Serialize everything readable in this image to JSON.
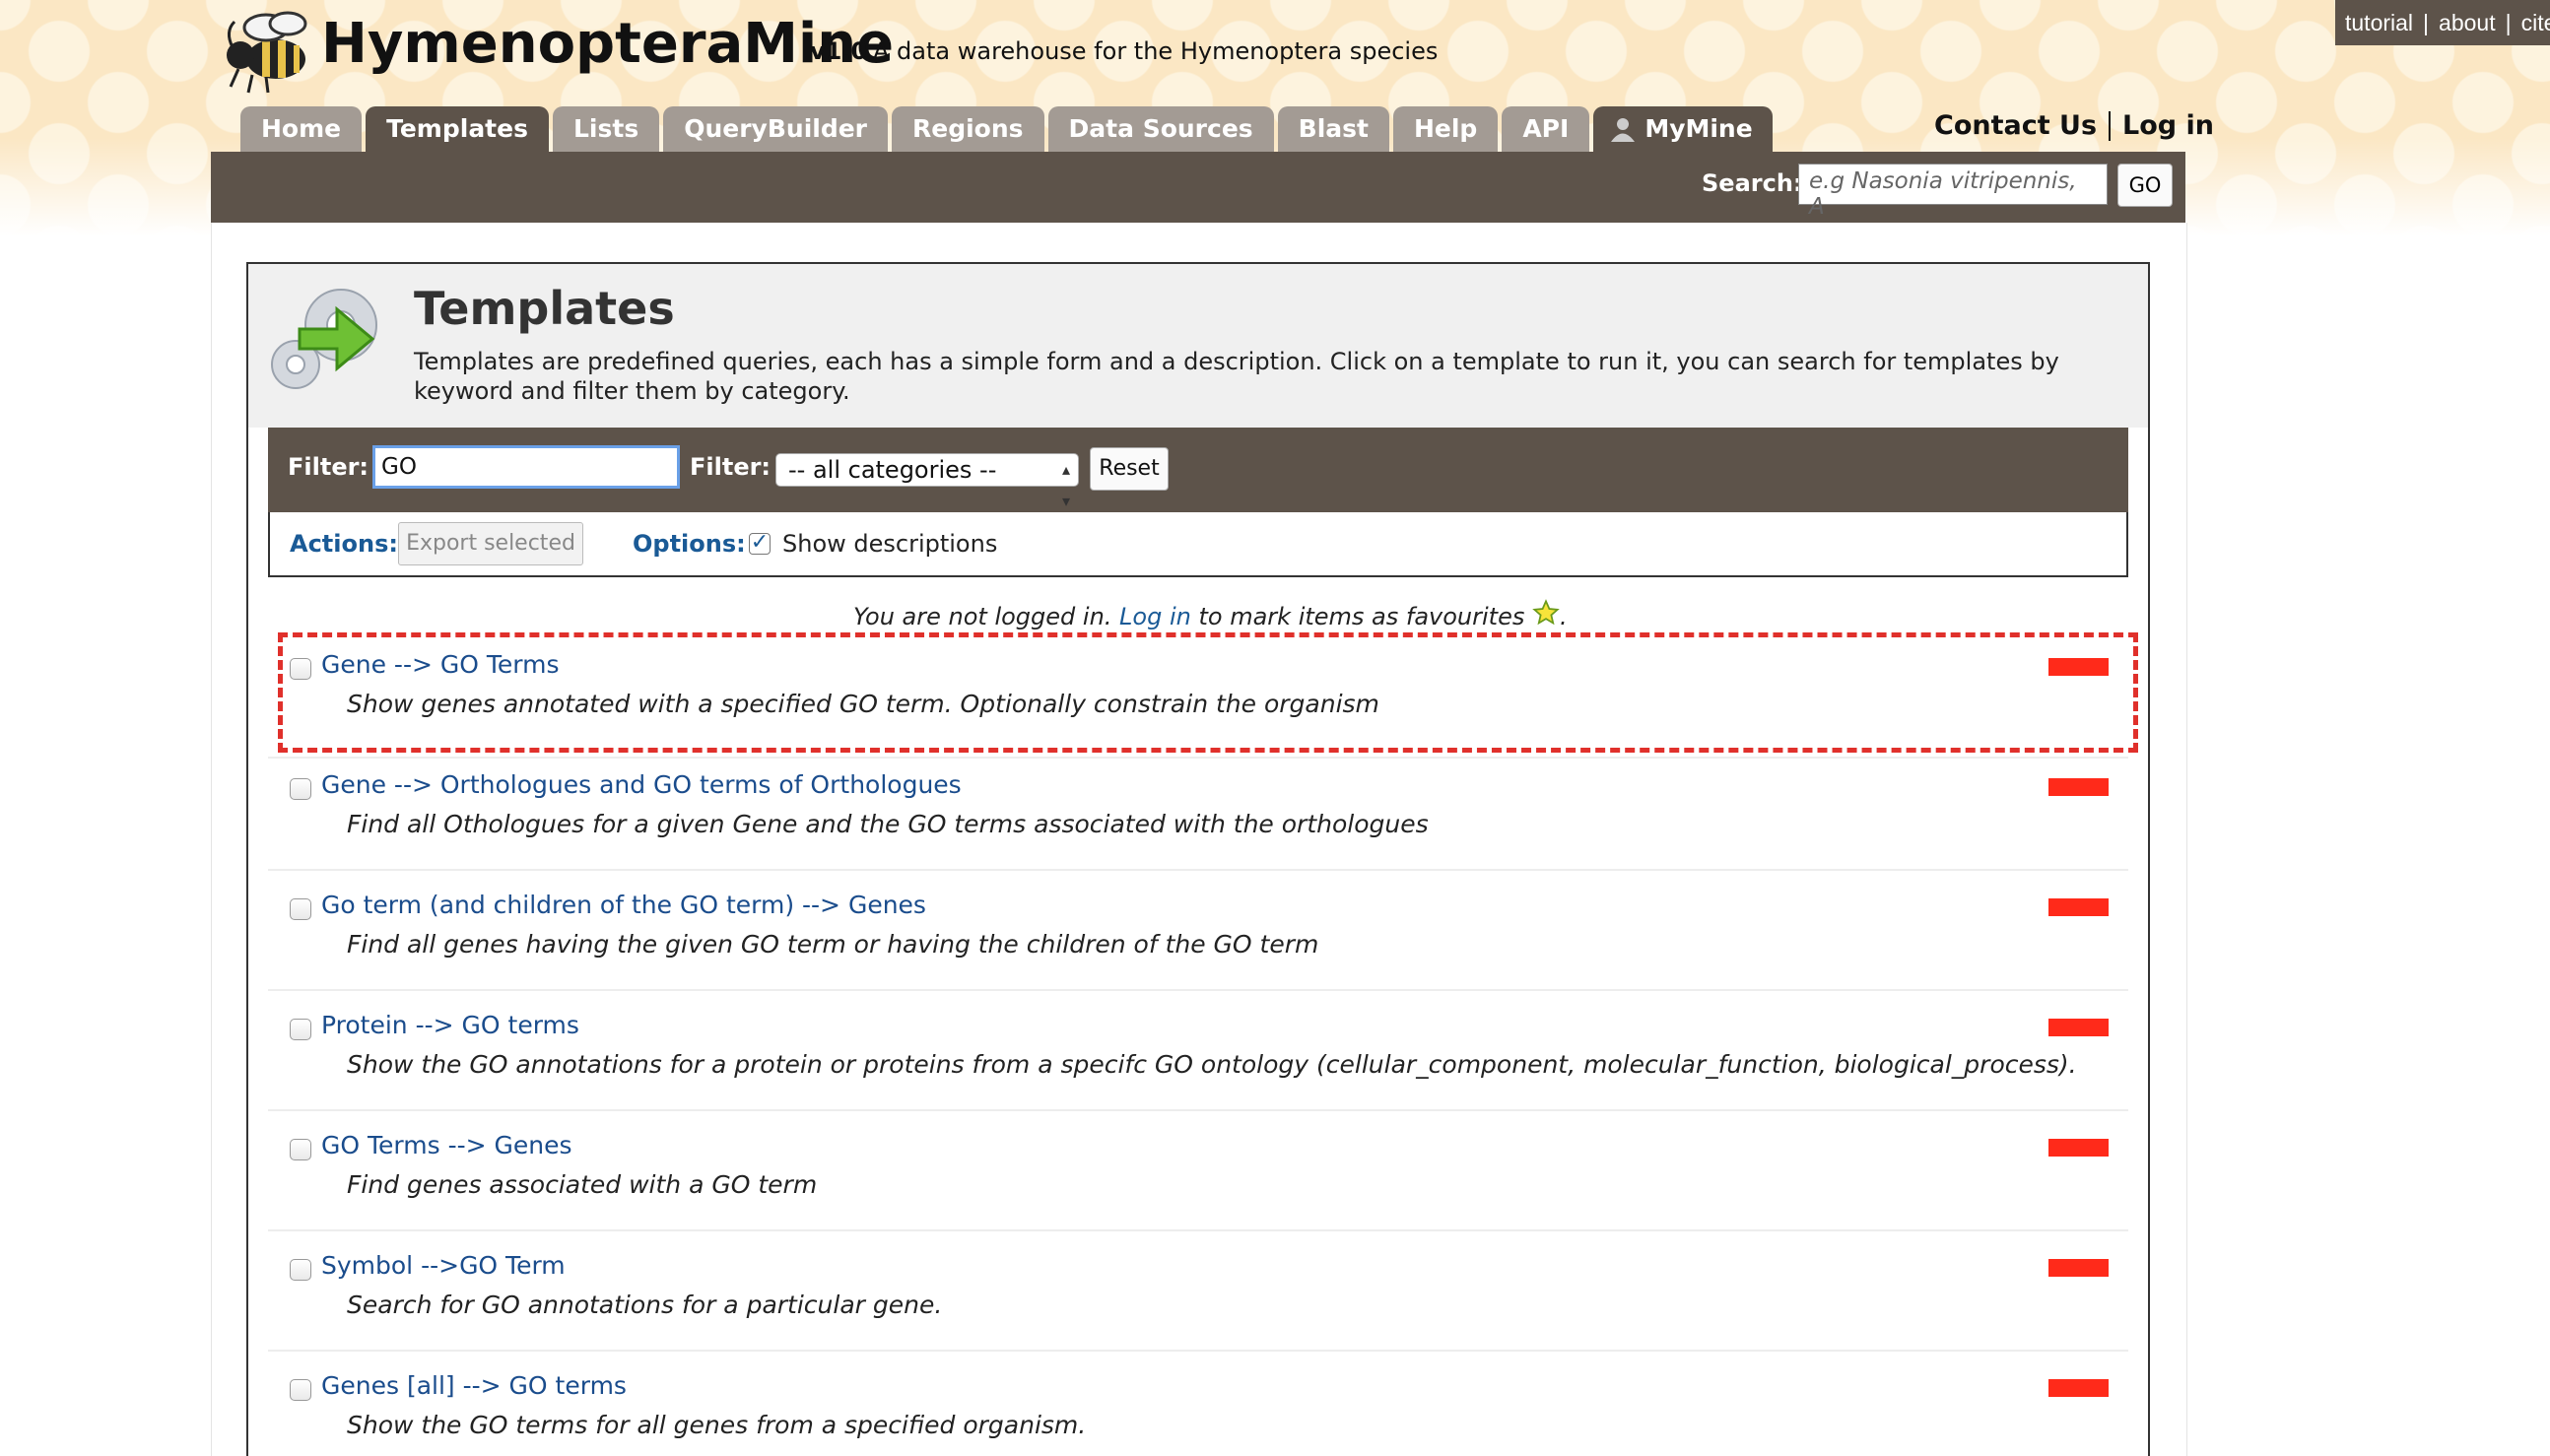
{
  "header": {
    "brand": "HymenopteraMine",
    "version": "v1.0",
    "tagline": "A data warehouse for the Hymenoptera species",
    "top_links": [
      "tutorial",
      "about",
      "cite"
    ],
    "tabs": [
      "Home",
      "Templates",
      "Lists",
      "QueryBuilder",
      "Regions",
      "Data Sources",
      "Blast",
      "Help",
      "API",
      "MyMine"
    ],
    "active_tab": "Templates",
    "contact_label": "Contact Us",
    "login_label": "Log in"
  },
  "search": {
    "label": "Search:",
    "placeholder": "e.g  Nasonia vitripennis, A",
    "button": "GO"
  },
  "page": {
    "title": "Templates",
    "description": "Templates are predefined queries, each has a simple form and a description. Click on a template to run it, you can search for templates by keyword and filter them by category."
  },
  "filters": {
    "filter_label": "Filter:",
    "filter_value": "GO",
    "category_label": "Filter:",
    "category_value": "-- all categories --",
    "reset_label": "Reset",
    "actions_label": "Actions:",
    "export_label": "Export selected",
    "options_label": "Options:",
    "show_descriptions_label": "Show descriptions",
    "show_descriptions_checked": true
  },
  "notice": {
    "before": "You are not logged in.",
    "link": "Log in",
    "after": "to mark items as favourites",
    "end": "."
  },
  "templates": [
    {
      "title": "Gene --> GO Terms",
      "description": "Show genes annotated with a specified GO term. Optionally constrain the organism"
    },
    {
      "title": "Gene --> Orthologues and GO terms of Orthologues",
      "description": "Find all Othologues for a given Gene and the GO terms associated with the orthologues"
    },
    {
      "title": "Go term (and children of the GO term) --> Genes",
      "description": "Find all genes having the given GO term or having the children of the GO term"
    },
    {
      "title": "Protein --> GO terms",
      "description": "Show the GO annotations for a protein or proteins from a specifc GO ontology (cellular_component, molecular_function, biological_process)."
    },
    {
      "title": "GO Terms --> Genes",
      "description": "Find genes associated with a GO term"
    },
    {
      "title": "Symbol -->GO Term",
      "description": "Search for GO annotations for a particular gene."
    },
    {
      "title": "Genes [all] --> GO terms",
      "description": "Show the GO terms for all genes from a specified organism."
    }
  ],
  "colors": {
    "nav_dark": "#5d534a",
    "nav_tab": "#a39b94",
    "link_blue": "#1a4c8c",
    "tag_red": "#ff2a1a",
    "highlight_red": "#e0302b"
  }
}
